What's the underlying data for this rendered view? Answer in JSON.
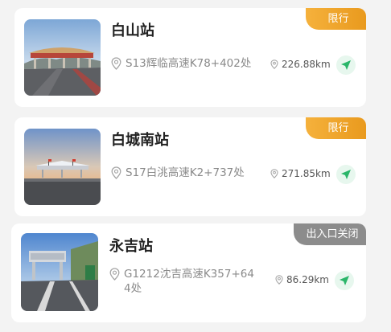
{
  "stations": [
    {
      "name": "白山站",
      "location": "S13辉临高速K78+402处",
      "distance": "226.88km",
      "tag": "限行",
      "tag_type": "limit"
    },
    {
      "name": "白城南站",
      "location": "S17白洮高速K2+737处",
      "distance": "271.85km",
      "tag": "限行",
      "tag_type": "limit"
    },
    {
      "name": "永吉站",
      "location": "G1212沈吉高速K357+644处",
      "distance": "86.29km",
      "tag": "出入口关闭",
      "tag_type": "closed"
    }
  ],
  "colors": {
    "limit_tag": "#eea42a",
    "closed_tag": "#8c8c8c",
    "nav_icon": "#2bb66a"
  },
  "icons": {
    "location": "map-pin-icon",
    "distance": "map-pin-icon",
    "navigate": "navigation-arrow-icon"
  }
}
